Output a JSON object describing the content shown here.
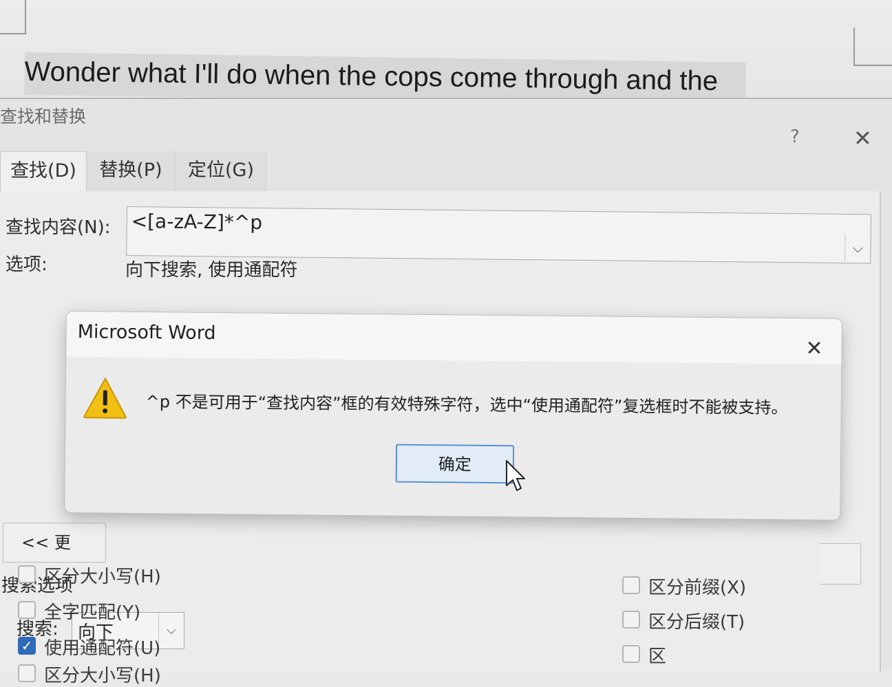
{
  "document": {
    "text": "Wonder what I'll do when the cops come through and the"
  },
  "find_replace_dialog": {
    "title": "查找和替换",
    "help": "?",
    "close": "✕",
    "tabs": [
      {
        "label": "查找(D)"
      },
      {
        "label": "替换(P)"
      },
      {
        "label": "定位(G)"
      }
    ],
    "find_label": "查找内容(N):",
    "find_value": "<[a-zA-Z]*^p",
    "options_label": "选项:",
    "options_value": "向下搜索, 使用通配符",
    "more_button": "<< 更",
    "search_options_label": "搜索选项",
    "search_label": "搜索:",
    "search_direction": "向下",
    "checkboxes_left": [
      {
        "label": "区分大小写(H)",
        "checked": false
      },
      {
        "label": "全字匹配(Y)",
        "checked": false
      },
      {
        "label": "使用通配符(U)",
        "checked": true
      }
    ],
    "checkboxes_right": [
      {
        "label": "区分前缀(X)",
        "checked": false
      },
      {
        "label": "区分后缀(T)",
        "checked": false
      },
      {
        "label": "区",
        "checked": false
      }
    ]
  },
  "alert": {
    "title": "Microsoft Word",
    "close": "✕",
    "message": "^p 不是可用于“查找内容”框的有效特殊字符，选中“使用通配符”复选框时不能被支持。",
    "ok_label": "确定",
    "icon": "warning-icon"
  }
}
